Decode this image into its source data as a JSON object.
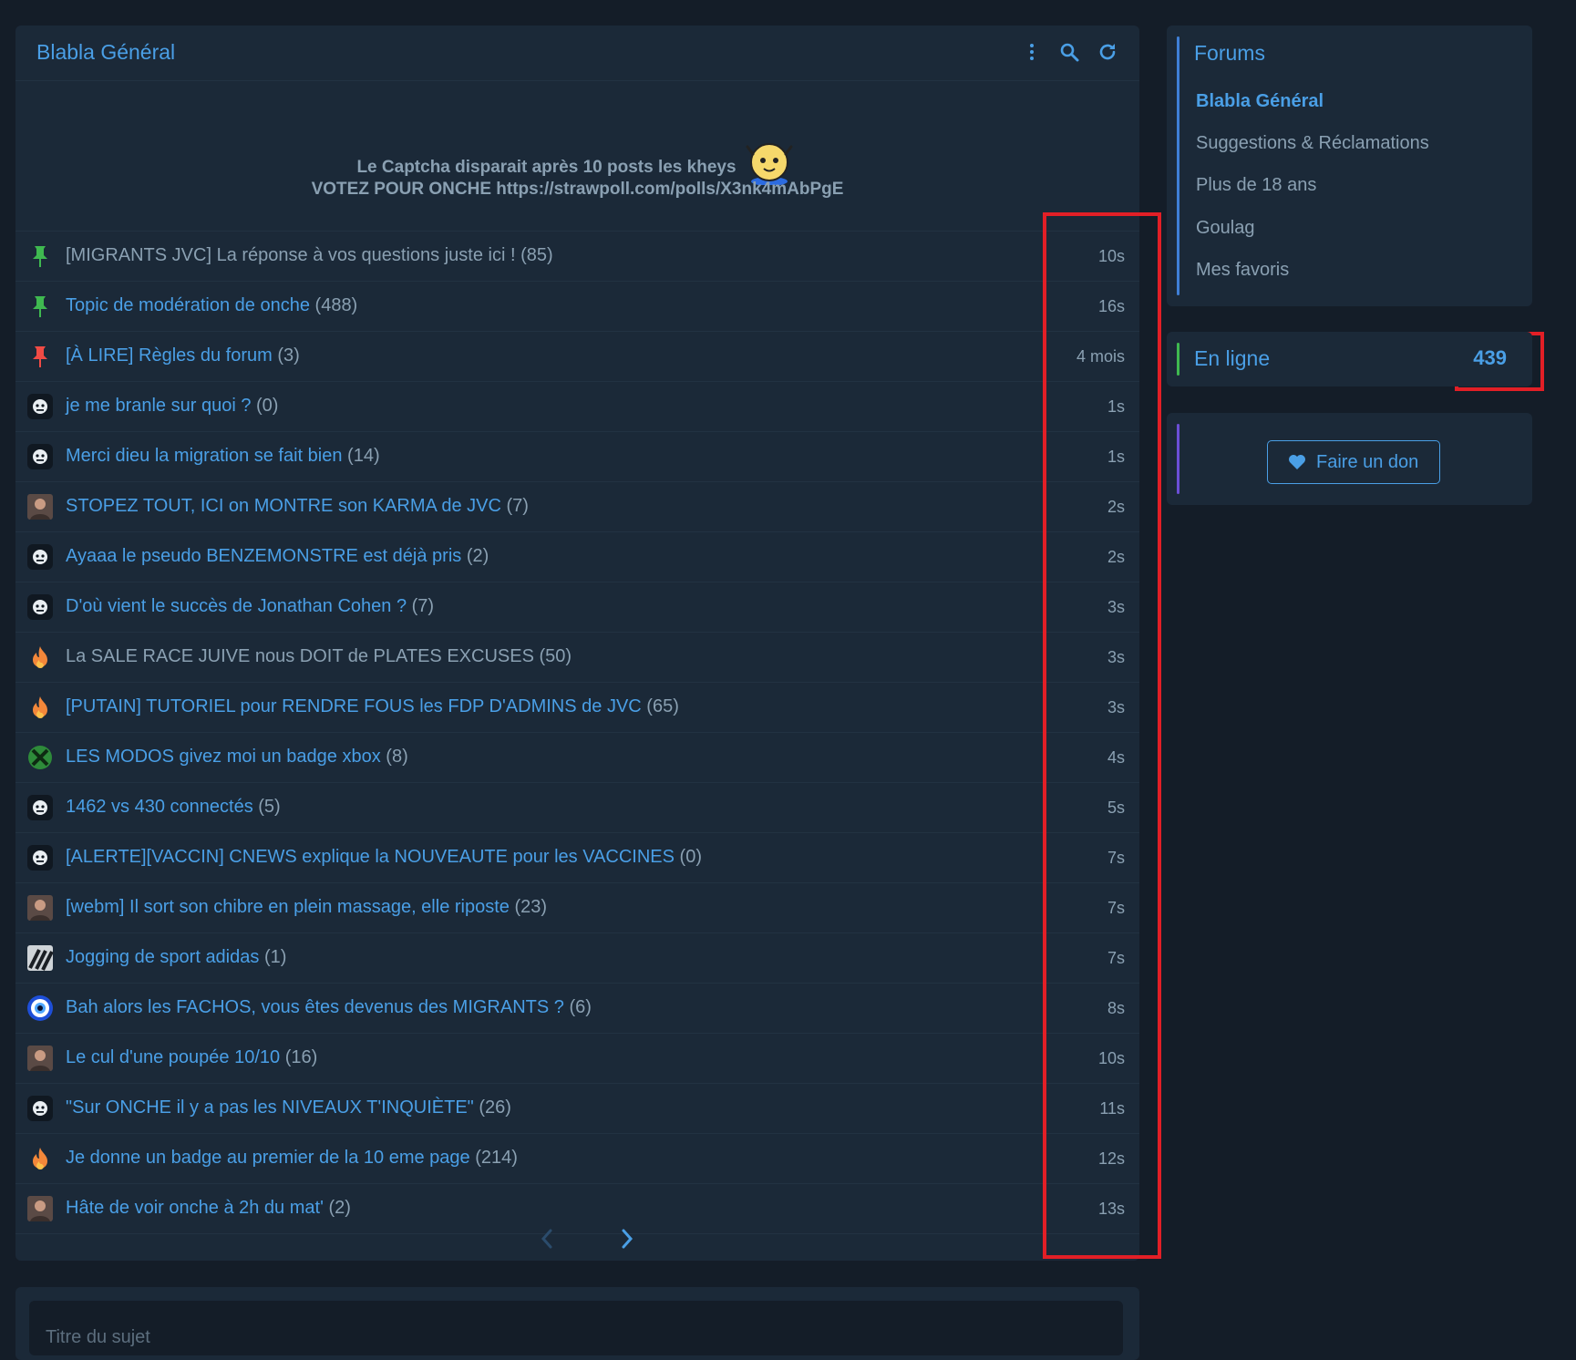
{
  "header": {
    "title": "Blabla Général",
    "icons": [
      "more-vertical-icon",
      "search-icon",
      "refresh-icon"
    ]
  },
  "banner": {
    "line1": "Le Captcha disparait après 10 posts les kheys",
    "line2_prefix": "VOTEZ POUR ONCHE",
    "line2_link": "https://strawpoll.com/polls/X3nk4mAbPgE"
  },
  "topics": [
    {
      "icon": "pin-green-icon",
      "title": "[MIGRANTS JVC] La réponse à vos questions juste ici !",
      "count": "(85)",
      "time": "10s",
      "read": true
    },
    {
      "icon": "pin-green-icon",
      "title": "Topic de modération de onche",
      "count": "(488)",
      "time": "16s",
      "read": false
    },
    {
      "icon": "pin-red-icon",
      "title": "[À LIRE] Règles du forum",
      "count": "(3)",
      "time": "4 mois",
      "read": false
    },
    {
      "icon": "onche-face-icon",
      "title": "je me branle sur quoi ?",
      "count": "(0)",
      "time": "1s",
      "read": false
    },
    {
      "icon": "onche-face-icon",
      "title": "Merci dieu la migration se fait bien",
      "count": "(14)",
      "time": "1s",
      "read": false
    },
    {
      "icon": "avatar-photo-icon",
      "title": "STOPEZ TOUT, ICI on MONTRE son KARMA de JVC",
      "count": "(7)",
      "time": "2s",
      "read": false
    },
    {
      "icon": "onche-face-icon",
      "title": "Ayaaa le pseudo BENZEMONSTRE est déjà pris",
      "count": "(2)",
      "time": "2s",
      "read": false
    },
    {
      "icon": "onche-face-icon",
      "title": "D'où vient le succès de Jonathan Cohen ?",
      "count": "(7)",
      "time": "3s",
      "read": false
    },
    {
      "icon": "fire-icon",
      "title": "La SALE RACE JUIVE nous DOIT de PLATES EXCUSES",
      "count": "(50)",
      "time": "3s",
      "read": true
    },
    {
      "icon": "fire-icon",
      "title": "[PUTAIN] TUTORIEL pour RENDRE FOUS les FDP D'ADMINS de JVC",
      "count": "(65)",
      "time": "3s",
      "read": false
    },
    {
      "icon": "xbox-icon",
      "title": "LES MODOS givez moi un badge xbox",
      "count": "(8)",
      "time": "4s",
      "read": false
    },
    {
      "icon": "onche-face-icon",
      "title": "1462 vs 430 connectés",
      "count": "(5)",
      "time": "5s",
      "read": false
    },
    {
      "icon": "onche-face-icon",
      "title": "[ALERTE][VACCIN] CNEWS explique la NOUVEAUTE pour les VACCINES",
      "count": "(0)",
      "time": "7s",
      "read": false
    },
    {
      "icon": "avatar-photo-icon",
      "title": "[webm] Il sort son chibre en plein massage, elle riposte",
      "count": "(23)",
      "time": "7s",
      "read": false
    },
    {
      "icon": "adidas-stripes-icon",
      "title": "Jogging de sport adidas",
      "count": "(1)",
      "time": "7s",
      "read": false
    },
    {
      "icon": "evil-eye-icon",
      "title": "Bah alors les FACHOS, vous êtes devenus des MIGRANTS ?",
      "count": "(6)",
      "time": "8s",
      "read": false
    },
    {
      "icon": "avatar-photo-icon",
      "title": "Le cul d'une poupée 10/10",
      "count": "(16)",
      "time": "10s",
      "read": false
    },
    {
      "icon": "onche-face-icon",
      "title": "\"Sur ONCHE il y a pas les NIVEAUX T'INQUIÈTE\"",
      "count": "(26)",
      "time": "11s",
      "read": false
    },
    {
      "icon": "fire-icon",
      "title": "Je donne un badge au premier de la 10 eme page",
      "count": "(214)",
      "time": "12s",
      "read": false
    },
    {
      "icon": "avatar-photo-icon",
      "title": "Hâte de voir onche à 2h du mat'",
      "count": "(2)",
      "time": "13s",
      "read": false
    }
  ],
  "pager": {
    "prev": "chevron-left-icon",
    "next": "chevron-right-icon"
  },
  "sidebar": {
    "forums_heading": "Forums",
    "forums": [
      {
        "label": "Blabla Général",
        "active": true
      },
      {
        "label": "Suggestions & Réclamations",
        "active": false
      },
      {
        "label": "Plus de 18 ans",
        "active": false
      },
      {
        "label": "Goulag",
        "active": false
      },
      {
        "label": "Mes favoris",
        "active": false
      }
    ],
    "online_label": "En ligne",
    "online_count": "439",
    "donate_label": "Faire un don"
  },
  "compose": {
    "subject_placeholder": "Titre du sujet"
  },
  "colors": {
    "accent": "#4a9fe6",
    "muted": "#8aa0b2",
    "highlight": "#e21f26",
    "pin_green": "#3fb950",
    "pin_red": "#f04b45",
    "fire": "#f3873a"
  }
}
